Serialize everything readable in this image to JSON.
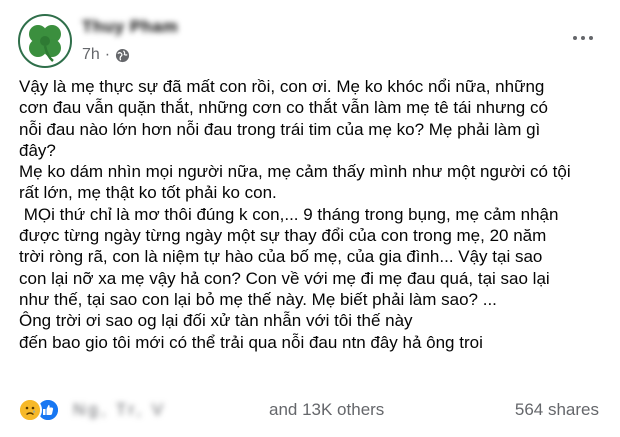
{
  "post": {
    "author_name": "Thuy Pham",
    "timestamp": "7h",
    "separator": "·",
    "audience_icon": "globe-icon",
    "more_icon": "more-options-icon",
    "lines": [
      "Vậy là mẹ thực sự đã mất con rồi, con ơi. Mẹ ko khóc nổi nữa, những",
      "cơn đau vẫn quặn thắt, những cơn co thắt vẫn làm mẹ tê tái nhưng có",
      "nỗi đau nào lớn hơn nỗi đau trong trái tim của mẹ ko? Mẹ phải làm gì",
      "đây?",
      "Mẹ ko dám nhìn mọi người nữa, mẹ cảm thấy mình như một người có tội",
      "rất lớn, mẹ thật ko tốt phải ko con.",
      " MỌi thứ chỉ là mơ thôi đúng k con,... 9 tháng trong bụng, mẹ cảm nhận",
      "được từng ngày từng ngày một sự thay đổi của con trong mẹ, 20 năm",
      "trời ròng rã, con là niệm tự hào của bố mẹ, của gia đình... Vậy tại sao",
      "con lại nỡ xa mẹ vậy hả con? Con về với mẹ đi mẹ đau quá, tại sao lại",
      "như thế, tại sao con lại bỏ mẹ thế này. Mẹ biết phải làm sao? ...",
      "Ông trời ơi sao og lại đối xử tàn nhẫn với tôi thế này",
      "đến bao gio tôi mới có thể trải qua nỗi đau ntn đây hả ông troi"
    ]
  },
  "footer": {
    "reaction_icons": [
      "sad-reaction-icon",
      "like-reaction-icon"
    ],
    "blurred_names": "Ng, Tr, V",
    "reaction_summary": "and 13K others",
    "shares": "564 shares"
  },
  "colors": {
    "text": "#050505",
    "secondary": "#65676b",
    "like_blue": "#1877f2",
    "sad_yellow": "#f7b928",
    "clover_green": "#3b8f3e"
  }
}
